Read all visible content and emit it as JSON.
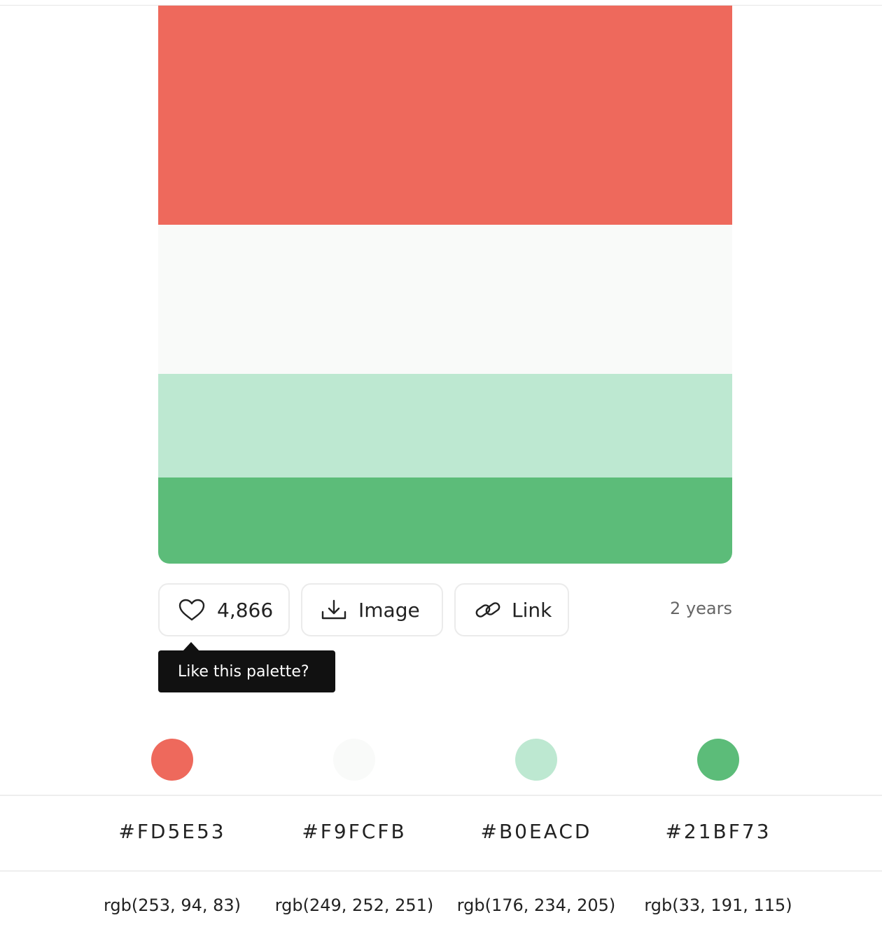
{
  "palette": {
    "swatches": [
      {
        "hex": "#FD5E53",
        "display": "#EE695C"
      },
      {
        "hex": "#F9FCFB",
        "display": "#F9FAF9"
      },
      {
        "hex": "#B0EACD",
        "display": "#BDE8D1"
      },
      {
        "hex": "#21BF73",
        "display": "#5CBC79"
      }
    ]
  },
  "actions": {
    "likes": "4,866",
    "like_icon": "heart-icon",
    "image_label": "Image",
    "image_icon": "download-icon",
    "link_label": "Link",
    "link_icon": "link-icon",
    "age": "2 years"
  },
  "tooltip": {
    "text": "Like this palette?"
  },
  "colors": [
    {
      "hex": "#FD5E53",
      "rgb": "rgb(253, 94, 83)"
    },
    {
      "hex": "#F9FCFB",
      "rgb": "rgb(249, 252, 251)"
    },
    {
      "hex": "#B0EACD",
      "rgb": "rgb(176, 234, 205)"
    },
    {
      "hex": "#21BF73",
      "rgb": "rgb(33, 191, 115)"
    }
  ]
}
